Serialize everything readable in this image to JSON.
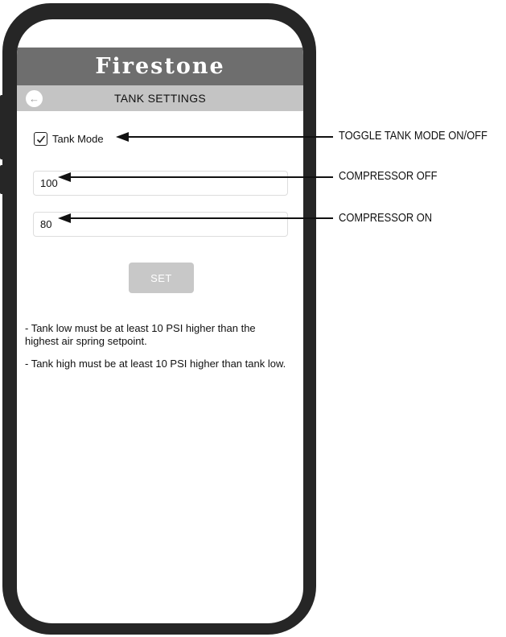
{
  "app": {
    "brand": "Firestone",
    "title": "TANK SETTINGS",
    "back_icon": "arrow-left-icon"
  },
  "tank_mode": {
    "label": "Tank Mode",
    "checked": true
  },
  "compressor_off": {
    "value": "100"
  },
  "compressor_on": {
    "value": "80"
  },
  "set_button": {
    "label": "SET"
  },
  "notes": [
    "- Tank low must be at least 10 PSI higher than the highest air spring setpoint.",
    "- Tank high must be at least 10 PSI higher than tank low."
  ],
  "annotations": {
    "toggle": "TOGGLE TANK MODE ON/OFF",
    "compressor_off": "COMPRESSOR OFF",
    "compressor_on": "COMPRESSOR ON"
  },
  "colors": {
    "frame": "#262626",
    "brand_bar": "#6e6e6e",
    "title_bar": "#c4c4c4",
    "button_disabled": "#c8c8c8"
  }
}
